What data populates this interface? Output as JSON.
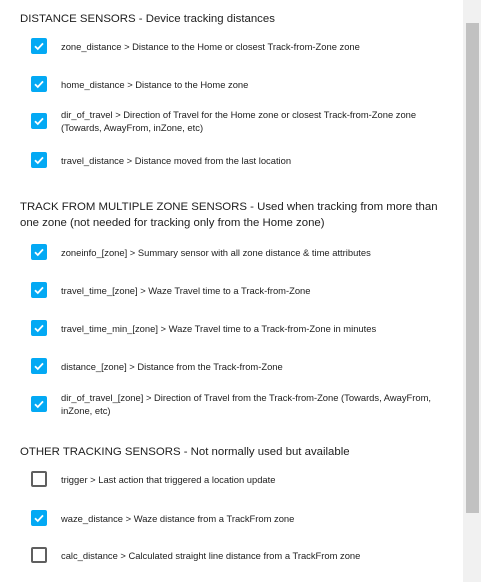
{
  "sections": [
    {
      "title": "DISTANCE SENSORS - Device tracking distances",
      "items": [
        {
          "label": "zone_distance > Distance to the Home or closest Track-from-Zone zone",
          "checked": true
        },
        {
          "label": "home_distance > Distance to the Home zone",
          "checked": true
        },
        {
          "label": "dir_of_travel > Direction of Travel for the Home zone or closest Track-from-Zone zone (Towards, AwayFrom, inZone, etc)",
          "checked": true
        },
        {
          "label": "travel_distance > Distance moved from the last location",
          "checked": true
        }
      ]
    },
    {
      "title": "TRACK FROM MULTIPLE ZONE SENSORS - Used when tracking from more than one zone (not needed for tracking only from the Home zone)",
      "items": [
        {
          "label": "zoneinfo_[zone] > Summary sensor with all zone distance & time attributes",
          "checked": true
        },
        {
          "label": "travel_time_[zone] > Waze Travel time to a Track-from-Zone",
          "checked": true
        },
        {
          "label": "travel_time_min_[zone] > Waze Travel time to a Track-from-Zone in minutes",
          "checked": true
        },
        {
          "label": "distance_[zone] > Distance from the Track-from-Zone",
          "checked": true
        },
        {
          "label": "dir_of_travel_[zone] > Direction of Travel from the Track-from-Zone (Towards, AwayFrom, inZone, etc)",
          "checked": true
        }
      ]
    },
    {
      "title": "OTHER TRACKING SENSORS - Not normally used but available",
      "items": [
        {
          "label": "trigger > Last action that triggered a location update",
          "checked": false
        },
        {
          "label": "waze_distance > Waze distance from a TrackFrom zone",
          "checked": true
        },
        {
          "label": "calc_distance > Calculated straight line distance from a TrackFrom zone",
          "checked": false
        }
      ]
    }
  ],
  "colors": {
    "checkbox_checked": "#03a9f4",
    "checkbox_unchecked_border": "#5f5f5f",
    "text": "#212121",
    "scrollbar_track": "#f1f1f1",
    "scrollbar_thumb": "#c1c1c1"
  }
}
